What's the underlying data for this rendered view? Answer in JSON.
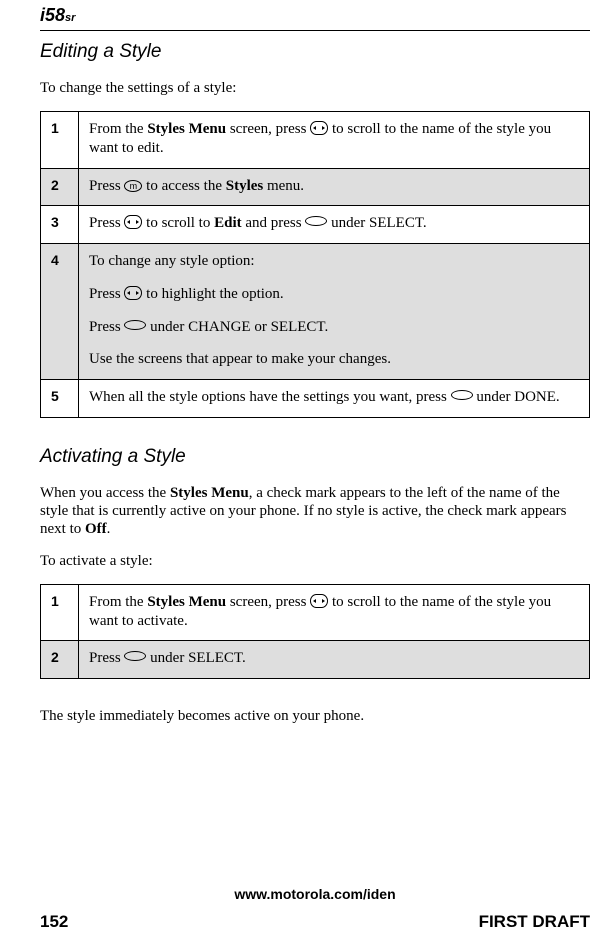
{
  "logo": {
    "prefix": "i",
    "num": "58",
    "suffix": "sr"
  },
  "section1_heading": "Editing a Style",
  "section1_intro": "To change the settings of a style:",
  "table1_steps": [
    {
      "num": "1",
      "icon1": "nav",
      "pre": "From the ",
      "bold1": "Styles Menu",
      "mid": " screen, press ",
      "post": " to scroll to the name of the style you want to edit."
    },
    {
      "num": "2",
      "icon1": "oval-m",
      "pre": "Press ",
      "mid": " to access the ",
      "bold1": "Styles",
      "post": " menu."
    },
    {
      "num": "3",
      "icon1": "nav",
      "icon2": "oval-blank",
      "pre": "Press ",
      "mid1": " to scroll to ",
      "bold1": "Edit",
      "mid2": " and press ",
      "post": " under SELECT."
    },
    {
      "num": "4",
      "lines": [
        "To change any style option:",
        {
          "pre": "Press ",
          "icon": "nav",
          "post": " to highlight the option."
        },
        {
          "pre": "Press ",
          "icon": "oval-blank",
          "post": " under CHANGE or SELECT."
        },
        "Use the screens that appear to make your changes."
      ]
    },
    {
      "num": "5",
      "icon1": "oval-blank",
      "pre": "When all the style options have the settings you want, press ",
      "post": " under DONE."
    }
  ],
  "section2_heading": "Activating a Style",
  "section2_para_pre": "When you access the ",
  "section2_para_bold1": "Styles Menu",
  "section2_para_mid": ", a check mark appears to the left of the name of the style that is currently active on your phone. If no style is active, the check mark appears next to ",
  "section2_para_bold2": "Off",
  "section2_para_post": ".",
  "section2_intro": "To activate a style:",
  "table2_steps": [
    {
      "num": "1",
      "icon1": "nav",
      "pre": "From the ",
      "bold1": "Styles Menu",
      "mid": " screen, press ",
      "post": " to scroll to the name of the style you want to activate."
    },
    {
      "num": "2",
      "icon1": "oval-blank",
      "pre": "Press ",
      "post": " under SELECT."
    }
  ],
  "section2_after": "The style immediately becomes active on your phone.",
  "footer_url": "www.motorola.com/iden",
  "footer_page": "152",
  "footer_draft": "FIRST DRAFT"
}
